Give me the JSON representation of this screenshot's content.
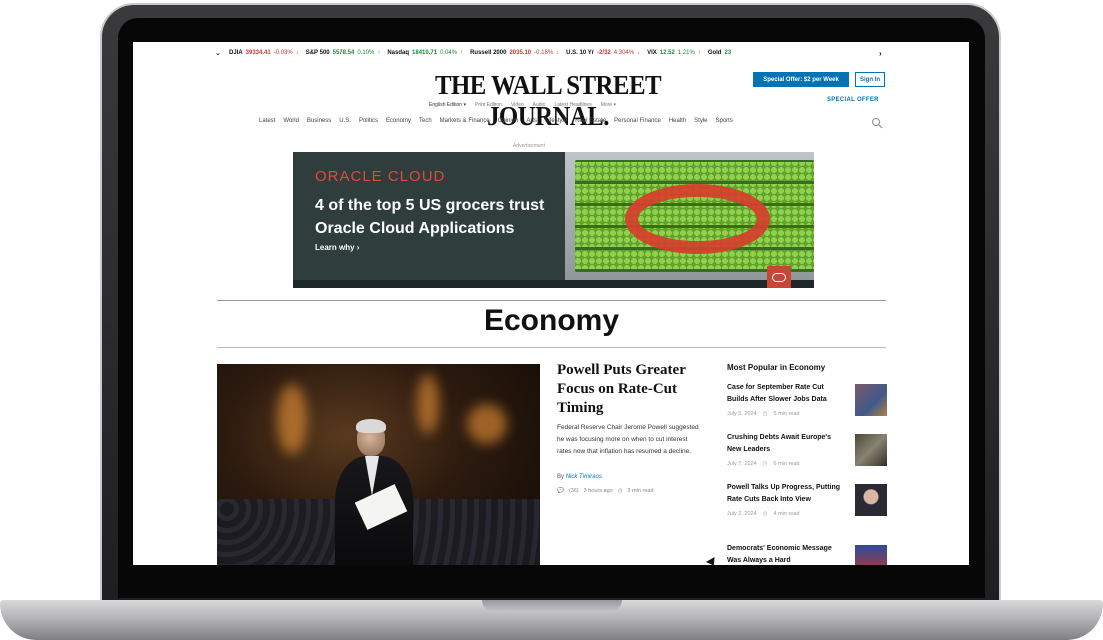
{
  "ticker": {
    "items": [
      {
        "symbol": "DJIA",
        "value": "39334.41",
        "change": "-0.03%",
        "arrow": "↓",
        "dir": "down"
      },
      {
        "symbol": "S&P 500",
        "value": "5578.54",
        "change": "0.10%",
        "arrow": "↑",
        "dir": "up"
      },
      {
        "symbol": "Nasdaq",
        "value": "18410.71",
        "change": "0.04%",
        "arrow": "↑",
        "dir": "up"
      },
      {
        "symbol": "Russell 2000",
        "value": "2035.10",
        "change": "-0.18%",
        "arrow": "↓",
        "dir": "down"
      },
      {
        "symbol": "U.S. 10 Yr",
        "value": "-2/32",
        "change": "4.304%",
        "arrow": "↓",
        "dir": "down"
      },
      {
        "symbol": "VIX",
        "value": "12.52",
        "change": "1.21%",
        "arrow": "↑",
        "dir": "up"
      },
      {
        "symbol": "Gold",
        "value": "23",
        "change": "",
        "arrow": "",
        "dir": "up"
      }
    ]
  },
  "header": {
    "masthead": "THE WALL STREET JOURNAL.",
    "edition_links": [
      "English Edition ▾",
      "Print Edition",
      "Video",
      "Audio",
      "Latest Headlines",
      "More ▾"
    ],
    "offer_button": "Special Offer: $2 per Week",
    "signin_button": "Sign In",
    "special_offer_link": "SPECIAL OFFER",
    "nav": [
      "Latest",
      "World",
      "Business",
      "U.S.",
      "Politics",
      "Economy",
      "Tech",
      "Markets & Finance",
      "Opinion",
      "Arts",
      "Lifestyle",
      "Real Estate",
      "Personal Finance",
      "Health",
      "Style",
      "Sports"
    ]
  },
  "ad": {
    "label": "Advertisement",
    "brand": "ORACLE CLOUD",
    "headline_line1": "4 of the top 5 US grocers trust",
    "headline_line2": "Oracle Cloud Applications",
    "link": "Learn why ›"
  },
  "section": {
    "title": "Economy"
  },
  "lead": {
    "headline": "Powell Puts Greater Focus on Rate-Cut Timing",
    "summary": "Federal Reserve Chair Jerome Powell suggested he was focusing more on when to cut interest rates now that inflation has resumed a decline.",
    "byline_prefix": "By",
    "author": "Nick Timiraos",
    "comments": "(36)",
    "time_ago": "3 hours ago",
    "read_time": "3 min read"
  },
  "popular": {
    "title": "Most Popular in Economy",
    "items": [
      {
        "headline": "Case for September Rate Cut Builds After Slower Jobs Data",
        "date": "July 5, 2024",
        "read": "5 min read"
      },
      {
        "headline": "Crushing Debts Await Europe's New Leaders",
        "date": "July 7, 2024",
        "read": "6 min read"
      },
      {
        "headline": "Powell Talks Up Progress, Putting Rate Cuts Back Into View",
        "date": "July 2, 2024",
        "read": "4 min read"
      },
      {
        "headline": "Democrats' Economic Message Was Always a Hard",
        "date": "",
        "read": ""
      }
    ]
  }
}
